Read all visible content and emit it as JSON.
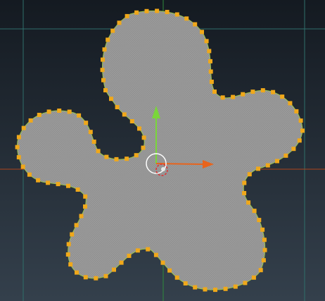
{
  "viewport": {
    "background_top": "#141a21",
    "background_bottom": "#34404c",
    "grid_line_color": "#2f6f6a",
    "axis_x_color": "#b0441c",
    "axis_y_color": "#2f8a3c"
  },
  "shape": {
    "fill": "#8c8c8c",
    "outline": "#9cc54a",
    "vertex_color": "#f0a81a",
    "vertex_count": 112
  },
  "gizmo": {
    "x_arrow_color": "#e8641c",
    "y_arrow_color": "#7ad63a",
    "center_color": "#ffffff",
    "pivot_color": "#e03030"
  },
  "icons": [
    "move-gizmo-icon",
    "pivot-icon"
  ]
}
